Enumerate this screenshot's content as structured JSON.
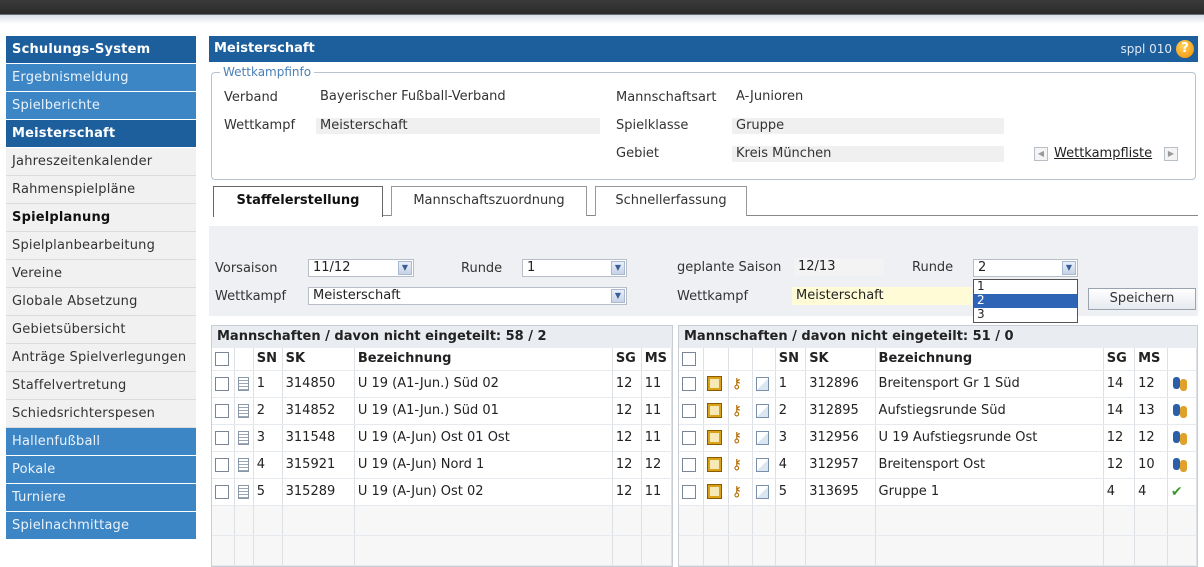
{
  "sidebar": {
    "items": [
      {
        "label": "Schulungs-System",
        "style": "head"
      },
      {
        "label": "Ergebnismeldung",
        "style": "blue"
      },
      {
        "label": "Spielberichte",
        "style": "blue"
      },
      {
        "label": "Meisterschaft",
        "style": "head"
      },
      {
        "label": "Jahreszeitenkalender",
        "style": "plain"
      },
      {
        "label": "Rahmenspielpläne",
        "style": "plain"
      },
      {
        "label": "Spielplanung",
        "style": "bold"
      },
      {
        "label": "Spielplanbearbeitung",
        "style": "plain"
      },
      {
        "label": "Vereine",
        "style": "plain"
      },
      {
        "label": "Globale Absetzung",
        "style": "plain"
      },
      {
        "label": "Gebietsübersicht",
        "style": "plain"
      },
      {
        "label": "Anträge Spielverlegungen",
        "style": "plain"
      },
      {
        "label": "Staffelvertretung",
        "style": "plain"
      },
      {
        "label": "Schiedsrichterspesen",
        "style": "plain"
      },
      {
        "label": "Hallenfußball",
        "style": "blue"
      },
      {
        "label": "Pokale",
        "style": "blue"
      },
      {
        "label": "Turniere",
        "style": "blue"
      },
      {
        "label": "Spielnachmittage",
        "style": "blue"
      }
    ]
  },
  "header": {
    "title": "Meisterschaft",
    "code": "sppl 010",
    "help": "?"
  },
  "wettkampfinfo": {
    "legend": "Wettkampfinfo",
    "verband_label": "Verband",
    "verband": "Bayerischer Fußball-Verband",
    "wettkampf_label": "Wettkampf",
    "wettkampf": "Meisterschaft",
    "mannschaftsart_label": "Mannschaftsart",
    "mannschaftsart": "A-Junioren",
    "spielklasse_label": "Spielklasse",
    "spielklasse": "Gruppe",
    "gebiet_label": "Gebiet",
    "gebiet": "Kreis München",
    "wettkampfliste_link": "Wettkampfliste"
  },
  "tabs": [
    "Staffelerstellung",
    "Mannschaftszuordnung",
    "Schnellerfassung"
  ],
  "form": {
    "vorsaison_label": "Vorsaison",
    "vorsaison": "11/12",
    "runde_label": "Runde",
    "runde_left": "1",
    "wettkampf_label": "Wettkampf",
    "wettkampf_left": "Meisterschaft",
    "geplante_saison_label": "geplante Saison",
    "geplante_saison": "12/13",
    "runde_right": "2",
    "wettkampf_right": "Meisterschaft",
    "runde_options": [
      "1",
      "2",
      "3"
    ],
    "runde_selected_index": 1,
    "save_label": "Speichern"
  },
  "left_table": {
    "title": "Mannschaften / davon nicht eingeteilt: 58 / 2",
    "columns": {
      "sn": "SN",
      "sk": "SK",
      "bez": "Bezeichnung",
      "sg": "SG",
      "ms": "MS"
    },
    "rows": [
      {
        "sn": "1",
        "sk": "314850",
        "bez": "U 19 (A1-Jun.) Süd 02",
        "sg": "12",
        "ms": "11"
      },
      {
        "sn": "2",
        "sk": "314852",
        "bez": "U 19 (A1-Jun.) Süd 01",
        "sg": "12",
        "ms": "11"
      },
      {
        "sn": "3",
        "sk": "311548",
        "bez": "U 19 (A-Jun) Ost 01 Ost",
        "sg": "12",
        "ms": "11"
      },
      {
        "sn": "4",
        "sk": "315921",
        "bez": "U 19 (A-Jun) Nord 1",
        "sg": "12",
        "ms": "12"
      },
      {
        "sn": "5",
        "sk": "315289",
        "bez": "U 19 (A-Jun) Ost 02",
        "sg": "12",
        "ms": "11"
      }
    ]
  },
  "right_table": {
    "title": "Mannschaften / davon nicht eingeteilt: 51 / 0",
    "columns": {
      "sn": "SN",
      "sk": "SK",
      "bez": "Bezeichnung",
      "sg": "SG",
      "ms": "MS"
    },
    "rows": [
      {
        "sn": "1",
        "sk": "312896",
        "bez": "Breitensport Gr 1 Süd",
        "sg": "14",
        "ms": "12",
        "icon": "team-icon"
      },
      {
        "sn": "2",
        "sk": "312895",
        "bez": "Aufstiegsrunde Süd",
        "sg": "14",
        "ms": "13",
        "icon": "team-icon"
      },
      {
        "sn": "3",
        "sk": "312956",
        "bez": "U 19 Aufstiegsrunde Ost",
        "sg": "12",
        "ms": "12",
        "icon": "team-icon"
      },
      {
        "sn": "4",
        "sk": "312957",
        "bez": "Breitensport Ost",
        "sg": "12",
        "ms": "10",
        "icon": "team-icon"
      },
      {
        "sn": "5",
        "sk": "313695",
        "bez": "Gruppe 1",
        "sg": "4",
        "ms": "4",
        "icon": "check-icon"
      }
    ]
  }
}
